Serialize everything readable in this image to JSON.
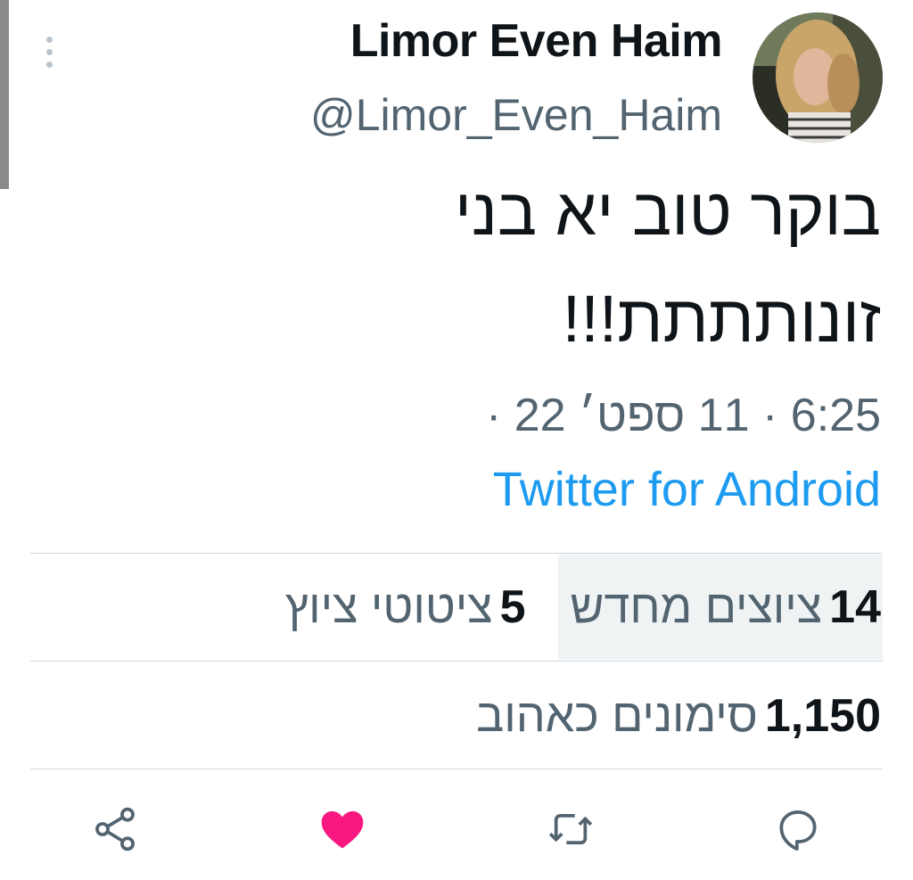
{
  "tweet": {
    "display_name": "Limor Even Haim",
    "handle": "@Limor_Even_Haim",
    "text_line1": "בוקר טוב יא בני",
    "text_line2": "זונותתתת!!!",
    "timestamp": "6:25 · 11 ספט׳ 22 ·",
    "source": "Twitter for Android"
  },
  "stats": {
    "retweets_count": "14",
    "retweets_label": "ציוצים מחדש",
    "quotes_count": "5",
    "quotes_label": "ציטוטי ציוץ",
    "likes_count": "1,150",
    "likes_label": "סימונים כאהוב"
  },
  "actions": {
    "reply_icon": "reply-icon",
    "retweet_icon": "retweet-icon",
    "like_icon": "heart-icon",
    "share_icon": "share-icon"
  },
  "colors": {
    "link": "#1d9bf0",
    "secondary_text": "#536471",
    "like_active": "#f91880",
    "icon": "#536471"
  }
}
